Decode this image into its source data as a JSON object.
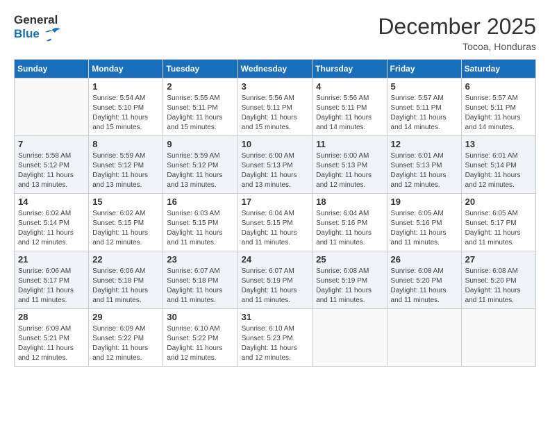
{
  "header": {
    "logo_general": "General",
    "logo_blue": "Blue",
    "month_year": "December 2025",
    "location": "Tocoa, Honduras"
  },
  "weekdays": [
    "Sunday",
    "Monday",
    "Tuesday",
    "Wednesday",
    "Thursday",
    "Friday",
    "Saturday"
  ],
  "weeks": [
    [
      {
        "day": "",
        "info": ""
      },
      {
        "day": "1",
        "info": "Sunrise: 5:54 AM\nSunset: 5:10 PM\nDaylight: 11 hours\nand 15 minutes."
      },
      {
        "day": "2",
        "info": "Sunrise: 5:55 AM\nSunset: 5:11 PM\nDaylight: 11 hours\nand 15 minutes."
      },
      {
        "day": "3",
        "info": "Sunrise: 5:56 AM\nSunset: 5:11 PM\nDaylight: 11 hours\nand 15 minutes."
      },
      {
        "day": "4",
        "info": "Sunrise: 5:56 AM\nSunset: 5:11 PM\nDaylight: 11 hours\nand 14 minutes."
      },
      {
        "day": "5",
        "info": "Sunrise: 5:57 AM\nSunset: 5:11 PM\nDaylight: 11 hours\nand 14 minutes."
      },
      {
        "day": "6",
        "info": "Sunrise: 5:57 AM\nSunset: 5:11 PM\nDaylight: 11 hours\nand 14 minutes."
      }
    ],
    [
      {
        "day": "7",
        "info": "Sunrise: 5:58 AM\nSunset: 5:12 PM\nDaylight: 11 hours\nand 13 minutes."
      },
      {
        "day": "8",
        "info": "Sunrise: 5:59 AM\nSunset: 5:12 PM\nDaylight: 11 hours\nand 13 minutes."
      },
      {
        "day": "9",
        "info": "Sunrise: 5:59 AM\nSunset: 5:12 PM\nDaylight: 11 hours\nand 13 minutes."
      },
      {
        "day": "10",
        "info": "Sunrise: 6:00 AM\nSunset: 5:13 PM\nDaylight: 11 hours\nand 13 minutes."
      },
      {
        "day": "11",
        "info": "Sunrise: 6:00 AM\nSunset: 5:13 PM\nDaylight: 11 hours\nand 12 minutes."
      },
      {
        "day": "12",
        "info": "Sunrise: 6:01 AM\nSunset: 5:13 PM\nDaylight: 11 hours\nand 12 minutes."
      },
      {
        "day": "13",
        "info": "Sunrise: 6:01 AM\nSunset: 5:14 PM\nDaylight: 11 hours\nand 12 minutes."
      }
    ],
    [
      {
        "day": "14",
        "info": "Sunrise: 6:02 AM\nSunset: 5:14 PM\nDaylight: 11 hours\nand 12 minutes."
      },
      {
        "day": "15",
        "info": "Sunrise: 6:02 AM\nSunset: 5:15 PM\nDaylight: 11 hours\nand 12 minutes."
      },
      {
        "day": "16",
        "info": "Sunrise: 6:03 AM\nSunset: 5:15 PM\nDaylight: 11 hours\nand 11 minutes."
      },
      {
        "day": "17",
        "info": "Sunrise: 6:04 AM\nSunset: 5:15 PM\nDaylight: 11 hours\nand 11 minutes."
      },
      {
        "day": "18",
        "info": "Sunrise: 6:04 AM\nSunset: 5:16 PM\nDaylight: 11 hours\nand 11 minutes."
      },
      {
        "day": "19",
        "info": "Sunrise: 6:05 AM\nSunset: 5:16 PM\nDaylight: 11 hours\nand 11 minutes."
      },
      {
        "day": "20",
        "info": "Sunrise: 6:05 AM\nSunset: 5:17 PM\nDaylight: 11 hours\nand 11 minutes."
      }
    ],
    [
      {
        "day": "21",
        "info": "Sunrise: 6:06 AM\nSunset: 5:17 PM\nDaylight: 11 hours\nand 11 minutes."
      },
      {
        "day": "22",
        "info": "Sunrise: 6:06 AM\nSunset: 5:18 PM\nDaylight: 11 hours\nand 11 minutes."
      },
      {
        "day": "23",
        "info": "Sunrise: 6:07 AM\nSunset: 5:18 PM\nDaylight: 11 hours\nand 11 minutes."
      },
      {
        "day": "24",
        "info": "Sunrise: 6:07 AM\nSunset: 5:19 PM\nDaylight: 11 hours\nand 11 minutes."
      },
      {
        "day": "25",
        "info": "Sunrise: 6:08 AM\nSunset: 5:19 PM\nDaylight: 11 hours\nand 11 minutes."
      },
      {
        "day": "26",
        "info": "Sunrise: 6:08 AM\nSunset: 5:20 PM\nDaylight: 11 hours\nand 11 minutes."
      },
      {
        "day": "27",
        "info": "Sunrise: 6:08 AM\nSunset: 5:20 PM\nDaylight: 11 hours\nand 11 minutes."
      }
    ],
    [
      {
        "day": "28",
        "info": "Sunrise: 6:09 AM\nSunset: 5:21 PM\nDaylight: 11 hours\nand 12 minutes."
      },
      {
        "day": "29",
        "info": "Sunrise: 6:09 AM\nSunset: 5:22 PM\nDaylight: 11 hours\nand 12 minutes."
      },
      {
        "day": "30",
        "info": "Sunrise: 6:10 AM\nSunset: 5:22 PM\nDaylight: 11 hours\nand 12 minutes."
      },
      {
        "day": "31",
        "info": "Sunrise: 6:10 AM\nSunset: 5:23 PM\nDaylight: 11 hours\nand 12 minutes."
      },
      {
        "day": "",
        "info": ""
      },
      {
        "day": "",
        "info": ""
      },
      {
        "day": "",
        "info": ""
      }
    ]
  ]
}
